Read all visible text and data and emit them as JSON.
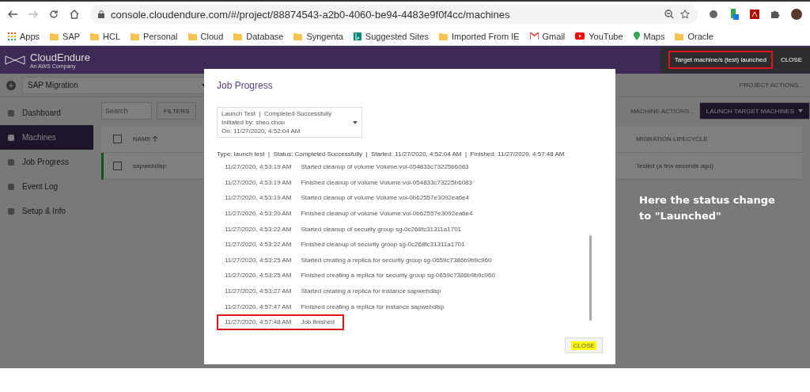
{
  "browser": {
    "url": "console.cloudendure.com/#/project/88874543-a2b0-4060-be94-4483e9f0f4cc/machines",
    "bookmarks": [
      {
        "label": "Apps",
        "kind": "apps"
      },
      {
        "label": "SAP",
        "kind": "folder"
      },
      {
        "label": "HCL",
        "kind": "folder"
      },
      {
        "label": "Personal",
        "kind": "folder"
      },
      {
        "label": "Cloud",
        "kind": "folder"
      },
      {
        "label": "Database",
        "kind": "folder"
      },
      {
        "label": "Syngenta",
        "kind": "folder"
      },
      {
        "label": "Suggested Sites",
        "kind": "bing"
      },
      {
        "label": "Imported From IE",
        "kind": "folder"
      },
      {
        "label": "Gmail",
        "kind": "mail"
      },
      {
        "label": "YouTube",
        "kind": "video"
      },
      {
        "label": "Maps",
        "kind": "pin"
      },
      {
        "label": "Oracle",
        "kind": "folder"
      }
    ]
  },
  "app": {
    "logo": "CloudEndure",
    "logo_tagline": "An AWS Company",
    "toast": {
      "text": "Target machine/s (test) launched",
      "highlighted": true,
      "action": "CLOSE"
    },
    "project": "SAP Migration",
    "project_actions": "PROJECT ACTIONS...",
    "sidebar": [
      {
        "label": "Dashboard",
        "selected": false
      },
      {
        "label": "Machines",
        "selected": true
      },
      {
        "label": "Job Progress",
        "selected": false
      },
      {
        "label": "Event Log",
        "selected": false
      },
      {
        "label": "Setup & Info",
        "selected": false
      }
    ],
    "search": {
      "placeholder": "Search"
    },
    "filters": "FILTERS",
    "machine_actions": "MACHINE ACTIONS...",
    "launch": "LAUNCH TARGET MACHINES",
    "table": {
      "columns": [
        "NAME",
        "MIGRATION LIFECYCLE"
      ],
      "all_checked": false,
      "rows": [
        {
          "name": "sapwebdisp",
          "lifecycle": "Tested (a few seconds ago)",
          "checked": false
        }
      ]
    }
  },
  "dialog": {
    "title": "Job Progress",
    "job_select": [
      "Launch Test  |  Completed Successfully",
      "Initiated by: sheo.chou",
      "On: 11/27/2020, 4:52:04 AM"
    ],
    "summary": "Type: launch test  |  Status: Completed Successfully  |  Started: 11/27/2020, 4:52:04 AM  |  Finished: 11/27/2020, 4:57:48 AM",
    "log": [
      {
        "time": "11/27/2020, 4:53:19 AM",
        "message": "Started cleanup of volume Volume:vol-054833c73225b6083",
        "highlighted": false
      },
      {
        "time": "11/27/2020, 4:53:19 AM",
        "message": "Finished cleanup of volume Volume:vol-054833c73225b6083",
        "highlighted": false
      },
      {
        "time": "11/27/2020, 4:53:19 AM",
        "message": "Started cleanup of volume Volume:vol-0b62557e3092ea6e4",
        "highlighted": false
      },
      {
        "time": "11/27/2020, 4:53:20 AM",
        "message": "Finished cleanup of volume Volume:vol-0b62557e3092ea6e4",
        "highlighted": false
      },
      {
        "time": "11/27/2020, 4:53:22 AM",
        "message": "Started cleanup of security group sg-0c268fc31311a1701",
        "highlighted": false
      },
      {
        "time": "11/27/2020, 4:53:22 AM",
        "message": "Finished cleanup of security group sg-0c268fc31311a1701",
        "highlighted": false
      },
      {
        "time": "11/27/2020, 4:53:25 AM",
        "message": "Started creating a replica for security group sg-0659c7386b9b9c960",
        "highlighted": false
      },
      {
        "time": "11/27/2020, 4:53:25 AM",
        "message": "Finished creating a replica for security group sg-0659c7386b9b9c960",
        "highlighted": false
      },
      {
        "time": "11/27/2020, 4:53:27 AM",
        "message": "Started creating a replica for instance sapwebdisp",
        "highlighted": false
      },
      {
        "time": "11/27/2020, 4:57:47 AM",
        "message": "Finished creating a replica for instance sapwebdisp",
        "highlighted": false
      },
      {
        "time": "11/27/2020, 4:57:48 AM",
        "message": "Job finished",
        "highlighted": true
      }
    ],
    "close": {
      "label": "CLOSE",
      "highlighted": true
    }
  },
  "annotation": "Here the status change to \"Launched\""
}
